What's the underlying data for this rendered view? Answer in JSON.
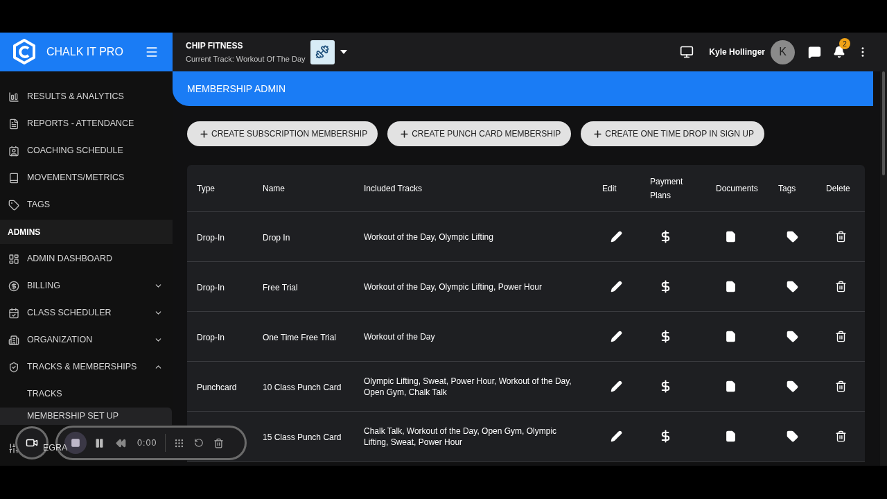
{
  "brand": {
    "name": "CHALK IT PRO"
  },
  "gym": {
    "name": "CHIP FITNESS",
    "track": "Current Track: Workout Of The Day"
  },
  "user": {
    "name": "Kyle Hollinger",
    "initial": "K",
    "notifications": "2"
  },
  "sidebar": {
    "items": [
      {
        "kind": "item",
        "label": "RESULTS & ANALYTICS",
        "selected": false
      },
      {
        "kind": "item",
        "label": "REPORTS - ATTENDANCE",
        "selected": false
      },
      {
        "kind": "item",
        "label": "COACHING SCHEDULE",
        "selected": false
      },
      {
        "kind": "item",
        "label": "MOVEMENTS/METRICS",
        "selected": false
      },
      {
        "kind": "item",
        "label": "TAGS",
        "selected": false
      },
      {
        "kind": "section",
        "label": "ADMINS"
      },
      {
        "kind": "item",
        "label": "ADMIN DASHBOARD",
        "selected": false
      },
      {
        "kind": "item",
        "label": "BILLING",
        "selected": false,
        "expanded": false
      },
      {
        "kind": "item",
        "label": "CLASS SCHEDULER",
        "selected": false,
        "expanded": false
      },
      {
        "kind": "item",
        "label": "ORGANIZATION",
        "selected": false,
        "expanded": false
      },
      {
        "kind": "item",
        "label": "TRACKS & MEMBERSHIPS",
        "selected": false,
        "expanded": true
      },
      {
        "kind": "subitem",
        "label": "TRACKS",
        "selected": false
      },
      {
        "kind": "subitem",
        "label": "MEMBERSHIP SET UP",
        "selected": true
      },
      {
        "kind": "item",
        "label": "EGRA",
        "selected": false
      }
    ]
  },
  "page_title": "MEMBERSHIP ADMIN",
  "actions": [
    "CREATE SUBSCRIPTION MEMBERSHIP",
    "CREATE PUNCH CARD MEMBERSHIP",
    "CREATE ONE TIME DROP IN SIGN UP"
  ],
  "table": {
    "columns": [
      "Type",
      "Name",
      "Included Tracks",
      "Edit",
      "Payment Plans",
      "Documents",
      "Tags",
      "Delete"
    ],
    "rows": [
      {
        "type": "Drop-In",
        "name": "Drop In",
        "tracks": "Workout of the Day, Olympic Lifting"
      },
      {
        "type": "Drop-In",
        "name": "Free Trial",
        "tracks": "Workout of the Day, Olympic Lifting, Power Hour"
      },
      {
        "type": "Drop-In",
        "name": "One Time Free Trial",
        "tracks": "Workout of the Day"
      },
      {
        "type": "Punchcard",
        "name": "10 Class Punch Card",
        "tracks": "Olympic Lifting, Sweat, Power Hour, Workout of the Day, Open Gym, Chalk Talk"
      },
      {
        "name": "15 Class Punch Card",
        "tracks": "Chalk Talk, Workout of the Day, Open Gym, Olympic Lifting, Sweat, Power Hour"
      }
    ]
  },
  "recorder": {
    "time": "0:00"
  }
}
